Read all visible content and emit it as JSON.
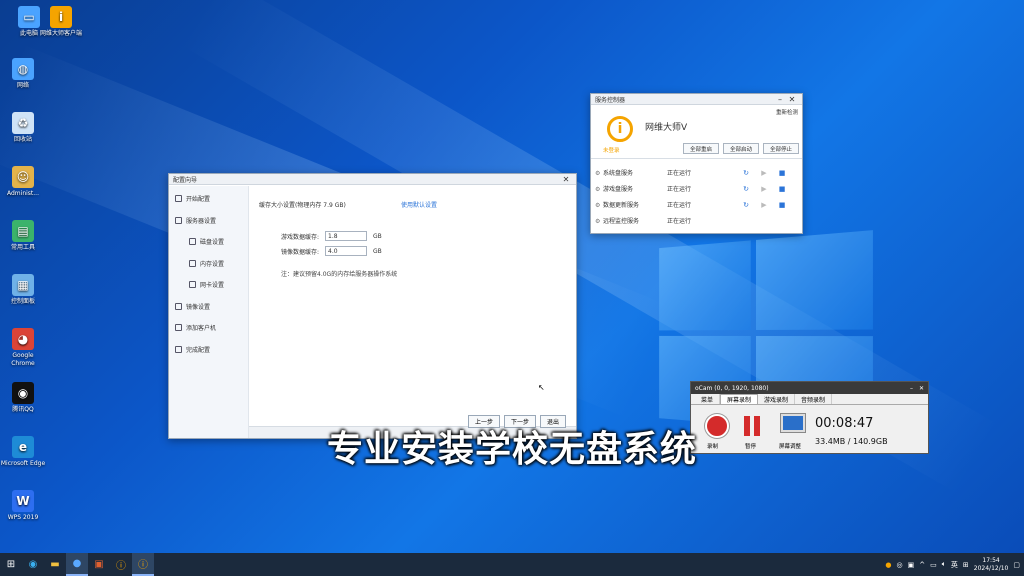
{
  "desktop": {
    "icons": [
      {
        "label": "此电脑",
        "icon": "computer-icon",
        "color": "#4aa3ff"
      },
      {
        "label": "网维大师客户端",
        "icon": "wangwei-icon",
        "color": "#f5a400"
      },
      {
        "label": "网络",
        "icon": "network-icon",
        "color": "#4aa3ff"
      },
      {
        "label": "回收站",
        "icon": "recycle-bin-icon",
        "color": "#cfe3f7"
      },
      {
        "label": "Administ...",
        "icon": "user-folder-icon",
        "color": "#e3b34b"
      },
      {
        "label": "常用工具",
        "icon": "tools-icon",
        "color": "#3bb36b"
      },
      {
        "label": "控制面板",
        "icon": "control-panel-icon",
        "color": "#6fb1e8"
      },
      {
        "label": "Google Chrome",
        "icon": "chrome-icon",
        "color": "#db4437"
      },
      {
        "label": "腾讯QQ",
        "icon": "qq-icon",
        "color": "#111111"
      },
      {
        "label": "Microsoft Edge",
        "icon": "edge-icon",
        "color": "#1e8bd6"
      },
      {
        "label": "WPS 2019",
        "icon": "wps-icon",
        "color": "#2d6ef0"
      }
    ]
  },
  "wizard": {
    "title": "配置向导",
    "nav": [
      {
        "label": "开始配置",
        "sub": false
      },
      {
        "label": "服务器设置",
        "sub": false
      },
      {
        "label": "磁盘设置",
        "sub": true
      },
      {
        "label": "内存设置",
        "sub": true
      },
      {
        "label": "网卡设置",
        "sub": true
      },
      {
        "label": "镜像设置",
        "sub": false
      },
      {
        "label": "添加客户机",
        "sub": false
      },
      {
        "label": "完成配置",
        "sub": false
      }
    ],
    "heading": "缓存大小设置(物理内存 7.9 GB)",
    "default_link": "使用默认设置",
    "read_label": "游戏数据缓存:",
    "read_value": "1.8",
    "write_label": "镜像数据缓存:",
    "write_value": "4.0",
    "unit": "GB",
    "note": "注：建议预留4.0G的内存给服务器操作系统",
    "buttons": [
      "上一步",
      "下一步",
      "退出"
    ]
  },
  "service_monitor": {
    "title": "服务控制器",
    "top_link": "重新检测",
    "app_name": "网维大师V",
    "badge": "未登录",
    "buttons": [
      "全部重启",
      "全部启动",
      "全部停止"
    ],
    "services": [
      {
        "name": "系统盘服务",
        "status": "正在运行"
      },
      {
        "name": "游戏盘服务",
        "status": "正在运行"
      },
      {
        "name": "数据更新服务",
        "status": "正在运行"
      },
      {
        "name": "远程监控服务",
        "status": "正在运行"
      }
    ],
    "accent": "#f5a400"
  },
  "ocam": {
    "title": "oCam (0, 0, 1920, 1080)",
    "tabs": [
      "菜单",
      "屏幕录制",
      "游戏录制",
      "音频录制"
    ],
    "record_label": "录制",
    "pause_label": "暂停",
    "screen_label": "屏幕调整",
    "timer": "00:08:47",
    "size": "33.4MB / 140.9GB"
  },
  "subtitle": "专业安装学校无盘系统",
  "taskbar": {
    "lang": "英",
    "time": "17:54",
    "date": "2024/12/10"
  }
}
